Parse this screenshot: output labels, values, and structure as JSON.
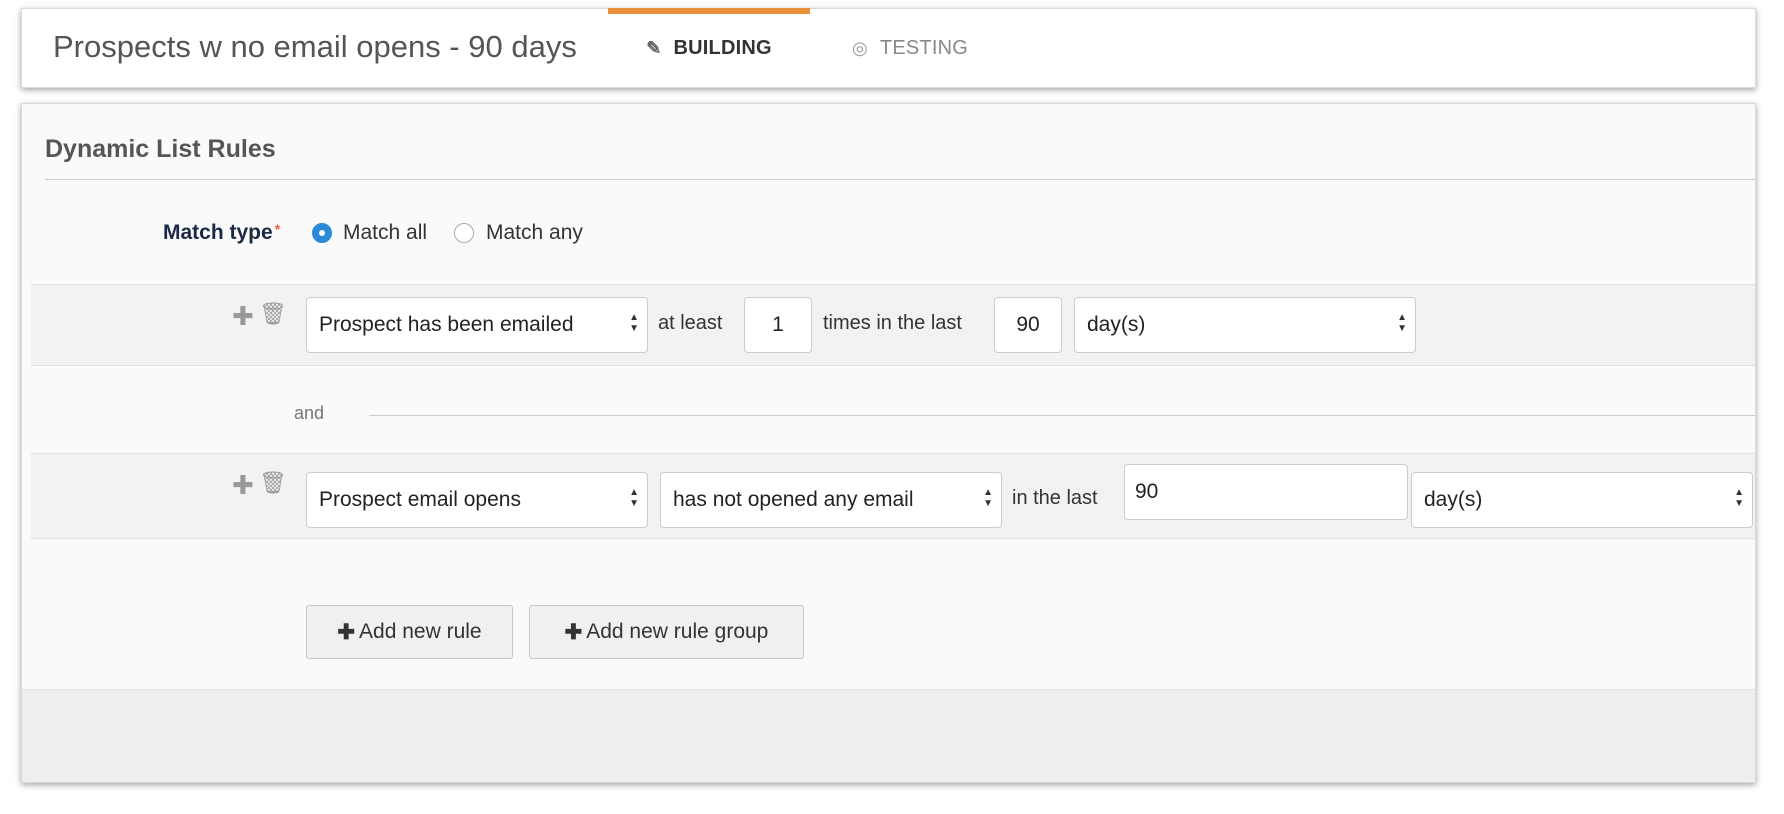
{
  "header": {
    "title": "Prospects w no email opens - 90 days",
    "tabs": [
      {
        "label": "BUILDING",
        "icon": "edit-icon",
        "active": true
      },
      {
        "label": "TESTING",
        "icon": "target-icon",
        "active": false
      }
    ],
    "accent_color": "#e8913a"
  },
  "panel": {
    "title": "Dynamic List Rules",
    "match_type": {
      "label": "Match type",
      "required_mark": "*",
      "options": [
        "Match all",
        "Match any"
      ],
      "selected": "Match all"
    },
    "rules": [
      {
        "field": "Prospect has been emailed",
        "text_1": "at least",
        "count": "1",
        "text_2": "times in the last",
        "days": "90",
        "unit": "day(s)"
      },
      {
        "field": "Prospect email opens",
        "operator": "has not opened any email",
        "text_1": "in the last",
        "days": "90",
        "unit": "day(s)"
      }
    ],
    "connector": "and",
    "buttons": {
      "add_rule": "Add new rule",
      "add_group": "Add new rule group",
      "plus": "✚"
    },
    "icons": {
      "add": "✚",
      "delete": "🗑"
    }
  }
}
